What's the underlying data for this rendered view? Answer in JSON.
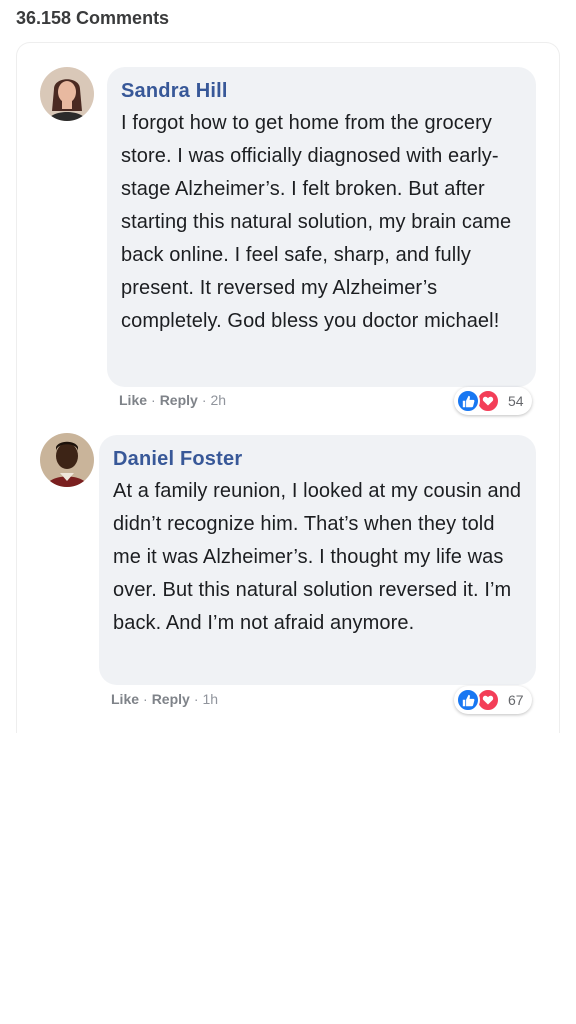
{
  "header": {
    "comment_count": "36.158 Comments"
  },
  "comments": [
    {
      "author": "Sandra Hill",
      "text": "I forgot how to get home from the grocery store. I was officially diagnosed with early-stage Alzheimer’s. I felt broken. But after starting this natural solution, my brain came back online. I feel safe, sharp, and fully present. It reversed my Alzheimer’s completely. God bless you doctor michael!",
      "like_label": "Like",
      "reply_label": "Reply",
      "time": "2h",
      "reaction_count": "54"
    },
    {
      "author": "Daniel Foster",
      "text": "At a family reunion, I looked at my cousin and didn’t recognize him. That’s when they told me it was Alzheimer’s. I thought my life was over. But this natural solution reversed it. I’m back. And I’m not afraid anymore.",
      "like_label": "Like",
      "reply_label": "Reply",
      "time": "1h",
      "reaction_count": "67"
    }
  ],
  "colors": {
    "author_name": "#385898",
    "bubble_bg": "#f0f2f5",
    "like_reaction": "#1877f2",
    "love_reaction": "#f33e58"
  },
  "icons": {
    "like_reaction": "thumbs-up-icon",
    "love_reaction": "heart-icon"
  }
}
